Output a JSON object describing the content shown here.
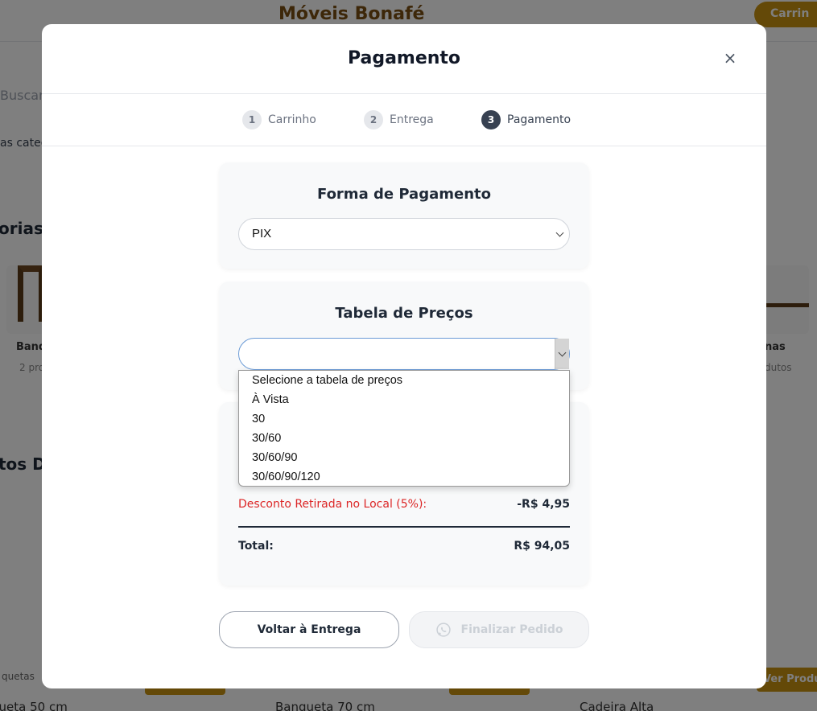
{
  "background": {
    "brand": "Móveis Bonafé",
    "cart_label": "Carrin",
    "search_placeholder": "Buscar p",
    "category_filter": "as categ",
    "section_categorias": "orias",
    "section_destaque": "tos Di",
    "category_left_name": "Banq",
    "category_left_count": "2 pro",
    "category_right_name": "nas",
    "category_right_count": "dutos",
    "product_1": "Banqueta 50 cm",
    "product_2": "Banqueta 70 cm",
    "product_3": "Cadeira Alta",
    "bottom_link": "quetas",
    "see_all_products": "Ver Produt"
  },
  "modal": {
    "title": "Pagamento",
    "close_glyph": "×",
    "steps": [
      {
        "number": "1",
        "label": "Carrinho",
        "active": false
      },
      {
        "number": "2",
        "label": "Entrega",
        "active": false
      },
      {
        "number": "3",
        "label": "Pagamento",
        "active": true
      }
    ],
    "payment_section": {
      "title": "Forma de Pagamento",
      "selected": "PIX"
    },
    "price_table_section": {
      "title": "Tabela de Preços",
      "selected": ""
    },
    "price_table_options": [
      "Selecione a tabela de preços",
      "À Vista",
      "30",
      "30/60",
      "30/60/90",
      "30/60/90/120"
    ],
    "summary": {
      "discount_label": "Desconto Retirada no Local (5%):",
      "discount_value": "-R$ 4,95",
      "total_label": "Total:",
      "total_value": "R$ 94,05"
    },
    "buttons": {
      "back": "Voltar à Entrega",
      "finish": "Finalizar Pedido"
    }
  },
  "colors": {
    "brand_gold": "#c89211",
    "discount_red": "#dc2626",
    "active_step": "#374151",
    "overlay": "rgba(0,0,0,0.5)"
  },
  "icons": {
    "close": "close-icon",
    "chevron": "chevron-down-icon",
    "whatsapp": "whatsapp-icon"
  }
}
